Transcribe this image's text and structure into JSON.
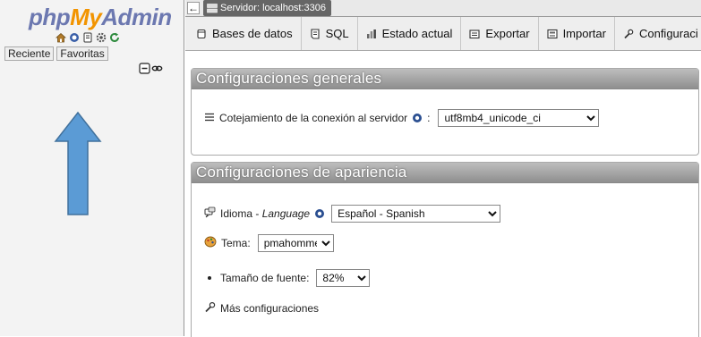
{
  "app": {
    "logo_php": "php",
    "logo_my": "My",
    "logo_admin": "Admin"
  },
  "left_panel": {
    "recent_label": "Reciente",
    "favorites_label": "Favoritas",
    "nav_icons": [
      "home-icon",
      "logout-icon",
      "docs-icon",
      "settings-icon",
      "reload-icon"
    ],
    "collapse_icons": [
      "collapse-all-icon",
      "link-icon"
    ]
  },
  "breadcrumb": {
    "server_label": "Servidor: localhost:3306"
  },
  "tabs": [
    {
      "label": "Bases de datos",
      "icon": "database-icon"
    },
    {
      "label": "SQL",
      "icon": "sql-icon"
    },
    {
      "label": "Estado actual",
      "icon": "status-icon"
    },
    {
      "label": "Exportar",
      "icon": "export-icon"
    },
    {
      "label": "Importar",
      "icon": "import-icon"
    },
    {
      "label": "Configuraci",
      "icon": "wrench-icon"
    }
  ],
  "general_settings": {
    "title": "Configuraciones generales",
    "collation_label": "Cotejamiento de la conexión al servidor",
    "collation_value": "utf8mb4_unicode_ci"
  },
  "appearance_settings": {
    "title": "Configuraciones de apariencia",
    "language_label": "Idioma",
    "language_label_en": "Language",
    "language_value": "Español - Spanish",
    "theme_label": "Tema:",
    "theme_value": "pmahomme",
    "font_size_label": "Tamaño de fuente:",
    "font_size_value": "82%",
    "more_settings_label": "Más configuraciones"
  },
  "colors": {
    "logo_blue": "#6c78b0",
    "logo_orange": "#f29400",
    "arrow_fill": "#5b9bd5",
    "arrow_stroke": "#41719c"
  }
}
